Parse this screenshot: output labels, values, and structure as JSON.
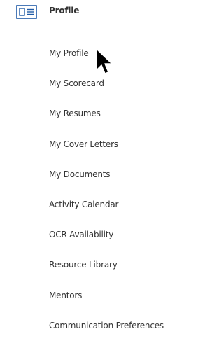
{
  "section": {
    "title": "Profile",
    "icon": "profile-card-icon",
    "icon_color": "#1f5aa6"
  },
  "menu": [
    {
      "label": "My Profile"
    },
    {
      "label": "My Scorecard"
    },
    {
      "label": "My Resumes"
    },
    {
      "label": "My Cover Letters"
    },
    {
      "label": "My Documents"
    },
    {
      "label": "Activity Calendar"
    },
    {
      "label": "OCR Availability"
    },
    {
      "label": "Resource Library"
    },
    {
      "label": "Mentors"
    },
    {
      "label": "Communication Preferences"
    }
  ],
  "cursor": {
    "icon": "mouse-pointer-icon"
  }
}
